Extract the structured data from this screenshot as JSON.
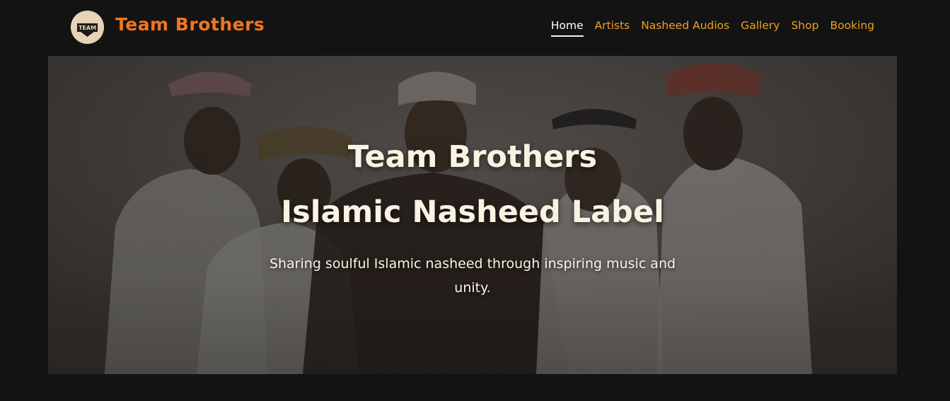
{
  "header": {
    "brand": "Team Brothers",
    "logo_text": "TEAM",
    "nav": [
      {
        "label": "Home",
        "active": true
      },
      {
        "label": "Artists"
      },
      {
        "label": "Nasheed Audios"
      },
      {
        "label": "Gallery"
      },
      {
        "label": "Shop"
      },
      {
        "label": "Booking"
      }
    ]
  },
  "hero": {
    "title_line1": "Team Brothers",
    "title_line2": "Islamic Nasheed Label",
    "subtitle": "Sharing soulful Islamic nasheed through inspiring music and unity."
  },
  "colors": {
    "background": "#131313",
    "brand": "#f0761e",
    "nav_link": "#f0a020",
    "nav_active": "#ffffff",
    "hero_text": "#fbf3e2"
  }
}
